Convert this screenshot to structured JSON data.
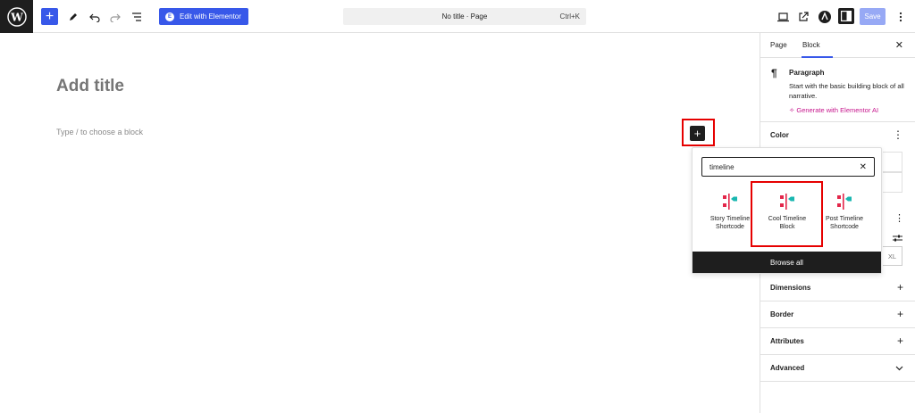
{
  "toolbar": {
    "elementor_label": "Edit with Elementor",
    "doc_title": "No title · Page",
    "shortcut": "Ctrl+K",
    "save_label": "Save"
  },
  "canvas": {
    "title_placeholder": "Add title",
    "block_placeholder": "Type / to choose a block"
  },
  "inserter": {
    "search_value": "timeline",
    "results": [
      {
        "label": "Story Timeline Shortcode"
      },
      {
        "label": "Cool Timeline Block"
      },
      {
        "label": "Post Timeline Shortcode"
      }
    ],
    "browse_all": "Browse all"
  },
  "sidebar": {
    "tabs": [
      "Page",
      "Block"
    ],
    "block_name": "Paragraph",
    "block_desc": "Start with the basic building block of all narrative.",
    "ai_link": "Generate with Elementor AI",
    "panels": {
      "color": "Color",
      "dimensions": "Dimensions",
      "border": "Border",
      "attributes": "Attributes",
      "advanced": "Advanced"
    },
    "size_label": "XL"
  },
  "colors": {
    "accent": "#3858e9",
    "highlight": "#e60000",
    "icon_red": "#e3264a",
    "icon_teal": "#1ab7b0",
    "ai_magenta": "#c6158c"
  }
}
